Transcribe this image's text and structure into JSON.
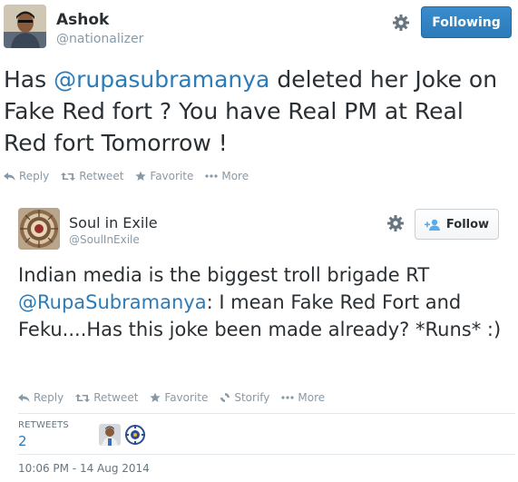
{
  "main_tweet": {
    "author_name": "Ashok",
    "author_handle": "@nationalizer",
    "follow_button_label": "Following",
    "text_prefix": "Has ",
    "mention": "@rupasubramanya",
    "text_suffix": " deleted her Joke on Fake Red fort ? You have Real PM at Real Red fort Tomorrow !",
    "actions": [
      {
        "label": "Reply",
        "icon": "reply-icon"
      },
      {
        "label": "Retweet",
        "icon": "retweet-icon"
      },
      {
        "label": "Favorite",
        "icon": "star-icon"
      },
      {
        "label": "More",
        "icon": "ellipsis-icon"
      }
    ]
  },
  "reply_tweet": {
    "author_name": "Soul in Exile",
    "author_handle": "@SoulInExile",
    "follow_button_label": "Follow",
    "text_prefix": "Indian media is the biggest troll brigade RT ",
    "mention": "@RupaSubramanya",
    "text_suffix": ": I mean Fake Red Fort and Feku....Has this joke been made already? *Runs* :)",
    "actions": [
      {
        "label": "Reply",
        "icon": "reply-icon"
      },
      {
        "label": "Retweet",
        "icon": "retweet-icon"
      },
      {
        "label": "Favorite",
        "icon": "star-icon"
      },
      {
        "label": "Storify",
        "icon": "storify-icon"
      },
      {
        "label": "More",
        "icon": "ellipsis-icon"
      }
    ],
    "stats": {
      "retweets_label": "RETWEETS",
      "retweets_count": "2"
    },
    "timestamp": "10:06 PM - 14 Aug 2014"
  },
  "colors": {
    "link": "#2b7bb9",
    "muted": "#8899a6",
    "text": "#292f33",
    "following_button": "#2b7bb9"
  }
}
